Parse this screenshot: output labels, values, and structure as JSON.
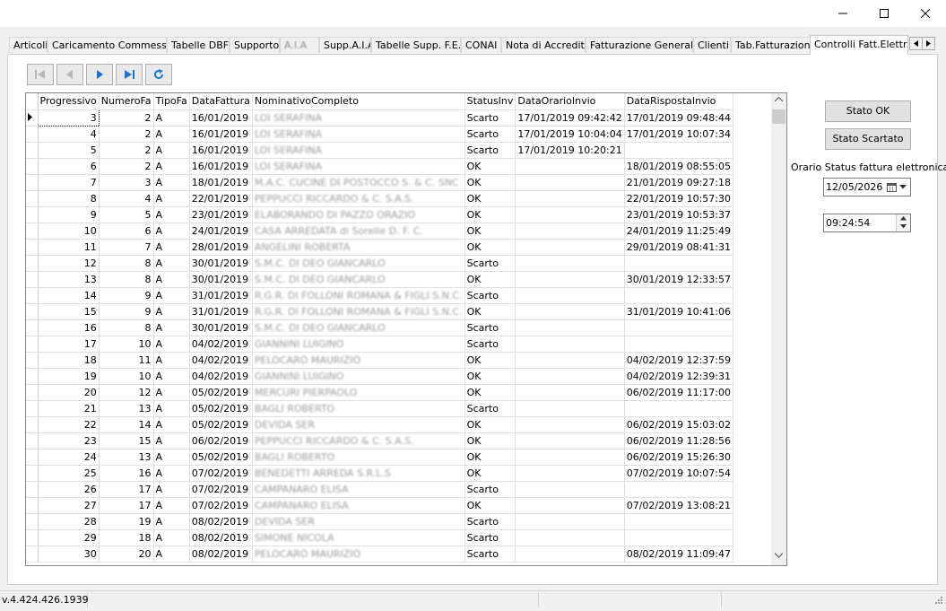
{
  "window": {
    "buttons": [
      "minimize",
      "maximize",
      "close"
    ]
  },
  "tabs": [
    {
      "label": "Articoli"
    },
    {
      "label": "Caricamento Commesse"
    },
    {
      "label": "Tabelle DBF"
    },
    {
      "label": "Supporto"
    },
    {
      "label": "A.I.A",
      "blurred": true
    },
    {
      "label": "Supp.A.I.A",
      "blurred": true
    },
    {
      "label": "Tabelle Supp. F.E."
    },
    {
      "label": "CONAI"
    },
    {
      "label": "Nota di Accredito"
    },
    {
      "label": "Fatturazione Generale"
    },
    {
      "label": "Clienti"
    },
    {
      "label": "Tab.Fatturazione"
    },
    {
      "label": "Controlli Fatt.Elettr.",
      "active": true
    }
  ],
  "grid": {
    "columns": [
      "Progressivo",
      "NumeroFa",
      "TipoFa",
      "DataFattura",
      "NominativoCompleto",
      "StatusInv",
      "DataOrarioInvio",
      "DataRispostaInvio"
    ],
    "rows": [
      [
        "3",
        "2",
        "A",
        "16/01/2019",
        "LOI SERAFINA",
        "Scarto",
        "17/01/2019 09:42:42",
        "17/01/2019 09:48:44"
      ],
      [
        "4",
        "2",
        "A",
        "16/01/2019",
        "LOI SERAFINA",
        "Scarto",
        "17/01/2019 10:04:04",
        "17/01/2019 10:07:34"
      ],
      [
        "5",
        "2",
        "A",
        "16/01/2019",
        "LOI SERAFINA",
        "Scarto",
        "17/01/2019 10:20:21",
        ""
      ],
      [
        "6",
        "2",
        "A",
        "16/01/2019",
        "LOI SERAFINA",
        "OK",
        "",
        "18/01/2019 08:55:05"
      ],
      [
        "7",
        "3",
        "A",
        "18/01/2019",
        "M.A.C. CUCINE DI POSTOCCO S. & C. SNC",
        "OK",
        "",
        "21/01/2019 09:27:18"
      ],
      [
        "8",
        "4",
        "A",
        "22/01/2019",
        "PEPPUCCI RICCARDO & C. S.A.S.",
        "OK",
        "",
        "22/01/2019 10:57:30"
      ],
      [
        "9",
        "5",
        "A",
        "23/01/2019",
        "ELABORANDO DI PAZZO ORAZIO",
        "OK",
        "",
        "23/01/2019 10:53:37"
      ],
      [
        "10",
        "6",
        "A",
        "24/01/2019",
        "CASA ARREDATA di Sorelle D. F. C.",
        "OK",
        "",
        "24/01/2019 11:25:49"
      ],
      [
        "11",
        "7",
        "A",
        "28/01/2019",
        "ANGELINI ROBERTA",
        "OK",
        "",
        "29/01/2019 08:41:31"
      ],
      [
        "12",
        "8",
        "A",
        "30/01/2019",
        "S.M.C. DI DEO GIANCARLO",
        "Scarto",
        "",
        ""
      ],
      [
        "13",
        "8",
        "A",
        "30/01/2019",
        "S.M.C. DI DEO GIANCARLO",
        "OK",
        "",
        "30/01/2019 12:33:57"
      ],
      [
        "14",
        "9",
        "A",
        "31/01/2019",
        "R.G.R. DI FOLLONI ROMANA & FIGLI S.N.C.",
        "Scarto",
        "",
        ""
      ],
      [
        "15",
        "9",
        "A",
        "31/01/2019",
        "R.G.R. DI FOLLONI ROMANA & FIGLI S.N.C.",
        "OK",
        "",
        "31/01/2019 10:41:06"
      ],
      [
        "16",
        "8",
        "A",
        "30/01/2019",
        "S.M.C. DI DEO GIANCARLO",
        "Scarto",
        "",
        ""
      ],
      [
        "17",
        "10",
        "A",
        "04/02/2019",
        "GIANNINI LUIGINO",
        "Scarto",
        "",
        ""
      ],
      [
        "18",
        "11",
        "A",
        "04/02/2019",
        "PELOCARO MAURIZIO",
        "OK",
        "",
        "04/02/2019 12:37:59"
      ],
      [
        "19",
        "10",
        "A",
        "04/02/2019",
        "GIANNINI LUIGINO",
        "OK",
        "",
        "04/02/2019 12:39:31"
      ],
      [
        "20",
        "12",
        "A",
        "05/02/2019",
        "MERCURI PIERPAOLO",
        "OK",
        "",
        "06/02/2019 11:17:00"
      ],
      [
        "21",
        "13",
        "A",
        "05/02/2019",
        "BAGLI ROBERTO",
        "Scarto",
        "",
        ""
      ],
      [
        "22",
        "14",
        "A",
        "05/02/2019",
        "DEVIDA SER",
        "OK",
        "",
        "06/02/2019 15:03:02"
      ],
      [
        "23",
        "15",
        "A",
        "06/02/2019",
        "PEPPUCCI RICCARDO & C. S.A.S.",
        "OK",
        "",
        "06/02/2019 11:28:56"
      ],
      [
        "24",
        "13",
        "A",
        "05/02/2019",
        "BAGLI ROBERTO",
        "OK",
        "",
        "06/02/2019 15:26:30"
      ],
      [
        "25",
        "16",
        "A",
        "07/02/2019",
        "BENEDETTI ARREDA S.R.L.S",
        "OK",
        "",
        "07/02/2019 10:07:54"
      ],
      [
        "26",
        "17",
        "A",
        "07/02/2019",
        "CAMPANARO ELISA",
        "Scarto",
        "",
        ""
      ],
      [
        "27",
        "17",
        "A",
        "07/02/2019",
        "CAMPANARO ELISA",
        "OK",
        "",
        "07/02/2019 13:08:21"
      ],
      [
        "28",
        "19",
        "A",
        "08/02/2019",
        "DEVIDA SER",
        "Scarto",
        "",
        ""
      ],
      [
        "29",
        "18",
        "A",
        "08/02/2019",
        "SIMONE NICOLA",
        "Scarto",
        "",
        ""
      ],
      [
        "30",
        "20",
        "A",
        "08/02/2019",
        "PELOCARO MAURIZIO",
        "Scarto",
        "",
        "08/02/2019 11:09:47"
      ]
    ]
  },
  "right": {
    "stato_ok": "Stato  OK",
    "stato_scartato": "Stato  Scartato",
    "orario_label": "Orario Status fattura elettronica",
    "date_value": "12/05/2026",
    "time_value": "09:24:54"
  },
  "statusbar": {
    "version": "v.4.424.426.1939"
  }
}
